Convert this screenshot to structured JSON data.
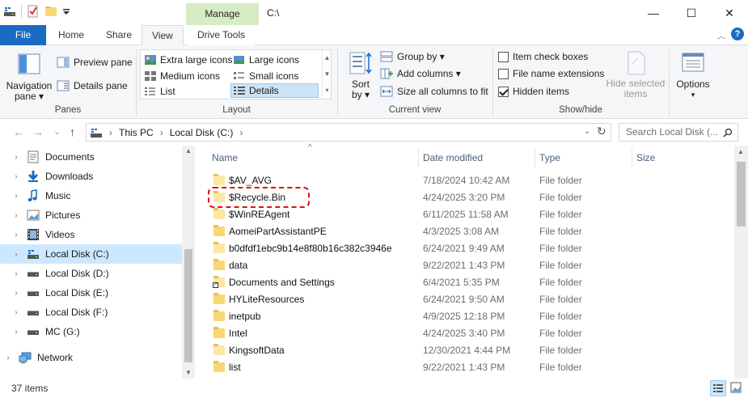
{
  "window": {
    "title_path": "C:\\",
    "context_tab": "Manage",
    "minimize": "—",
    "maximize": "☐",
    "close": "✕"
  },
  "tabs": [
    {
      "label": "File"
    },
    {
      "label": "Home"
    },
    {
      "label": "Share"
    },
    {
      "label": "View"
    },
    {
      "label": "Drive Tools"
    }
  ],
  "help_label": "?",
  "ribbon": {
    "panes": {
      "navigation_pane": "Navigation",
      "navigation_pane_2": "pane ▾",
      "preview_pane": "Preview pane",
      "details_pane": "Details pane",
      "label": "Panes"
    },
    "layout": {
      "items": [
        {
          "label": "Extra large icons"
        },
        {
          "label": "Large icons"
        },
        {
          "label": "Medium icons"
        },
        {
          "label": "Small icons"
        },
        {
          "label": "List"
        },
        {
          "label": "Details"
        }
      ],
      "selected": "Details",
      "label": "Layout"
    },
    "current_view": {
      "sort_by": "Sort",
      "sort_by_2": "by ▾",
      "group_by": "Group by ▾",
      "add_columns": "Add columns ▾",
      "size_all_columns": "Size all columns to fit",
      "label": "Current view"
    },
    "show_hide": {
      "item_check_boxes": "Item check boxes",
      "file_name_extensions": "File name extensions",
      "hidden_items": "Hidden items",
      "hidden_items_checked": true,
      "hide_selected": "Hide selected",
      "hide_selected_2": "items",
      "label": "Show/hide"
    },
    "options": {
      "label": "Options",
      "caret": "▾"
    }
  },
  "address": {
    "back": "←",
    "forward": "→",
    "recent": "⌄",
    "up": "↑",
    "crumbs": [
      "This PC",
      "Local Disk (C:)"
    ],
    "search_placeholder": "Search Local Disk (..."
  },
  "nav_pane": {
    "items": [
      {
        "label": "Documents",
        "icon": "documents-icon"
      },
      {
        "label": "Downloads",
        "icon": "downloads-icon"
      },
      {
        "label": "Music",
        "icon": "music-icon"
      },
      {
        "label": "Pictures",
        "icon": "pictures-icon"
      },
      {
        "label": "Videos",
        "icon": "videos-icon"
      },
      {
        "label": "Local Disk (C:)",
        "icon": "drive-icon",
        "selected": true
      },
      {
        "label": "Local Disk (D:)",
        "icon": "drive-icon"
      },
      {
        "label": "Local Disk (E:)",
        "icon": "drive-icon"
      },
      {
        "label": "Local Disk (F:)",
        "icon": "drive-icon"
      },
      {
        "label": "MC (G:)",
        "icon": "drive-icon"
      },
      {
        "label": "Network",
        "icon": "network-icon"
      }
    ]
  },
  "columns": {
    "name": "Name",
    "date": "Date modified",
    "type": "Type",
    "size": "Size"
  },
  "files": [
    {
      "name": "$AV_AVG",
      "date": "7/18/2024 10:42 AM",
      "type": "File folder"
    },
    {
      "name": "$Recycle.Bin",
      "date": "4/24/2025 3:20 PM",
      "type": "File folder"
    },
    {
      "name": "$WinREAgent",
      "date": "6/11/2025 11:58 AM",
      "type": "File folder"
    },
    {
      "name": "AomeiPartAssistantPE",
      "date": "4/3/2025 3:08 AM",
      "type": "File folder"
    },
    {
      "name": "b0dfdf1ebc9b14e8f80b16c382c3946e",
      "date": "6/24/2021 9:49 AM",
      "type": "File folder"
    },
    {
      "name": "data",
      "date": "9/22/2021 1:43 PM",
      "type": "File folder"
    },
    {
      "name": "Documents and Settings",
      "date": "6/4/2021 5:35 PM",
      "type": "File folder"
    },
    {
      "name": "HYLiteResources",
      "date": "6/24/2021 9:50 AM",
      "type": "File folder"
    },
    {
      "name": "inetpub",
      "date": "4/9/2025 12:18 PM",
      "type": "File folder"
    },
    {
      "name": "Intel",
      "date": "4/24/2025 3:40 PM",
      "type": "File folder"
    },
    {
      "name": "KingsoftData",
      "date": "12/30/2021 4:44 PM",
      "type": "File folder"
    },
    {
      "name": "list",
      "date": "9/22/2021 1:43 PM",
      "type": "File folder"
    }
  ],
  "status": {
    "item_count": "37 items"
  },
  "colors": {
    "accent": "#1a6cc2",
    "manage_tab": "#d7ebc4",
    "selection": "#cce8ff",
    "highlight_box": "#e01010",
    "folder": "#f8d775"
  }
}
